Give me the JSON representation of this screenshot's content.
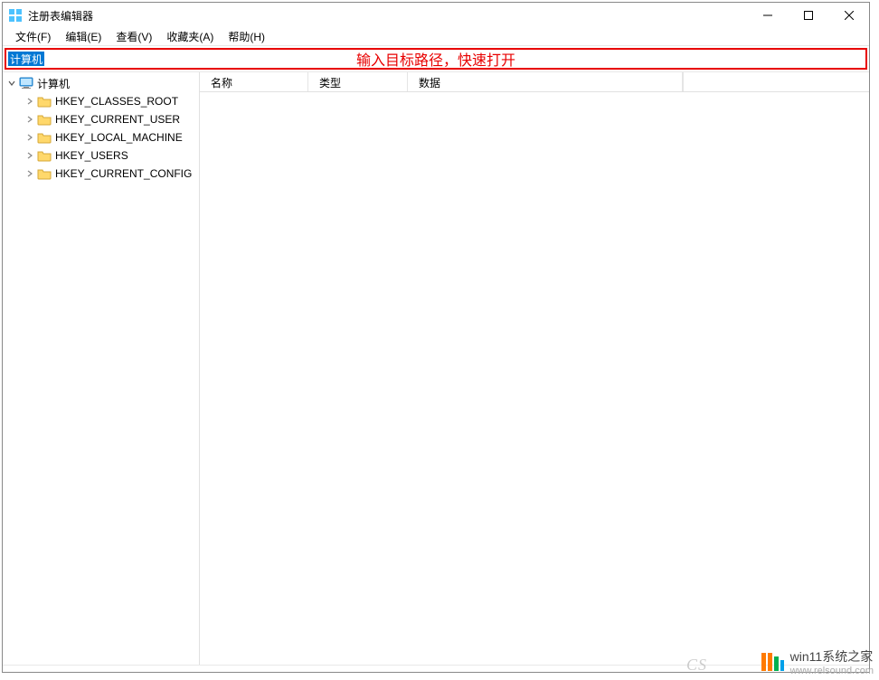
{
  "titlebar": {
    "title": "注册表编辑器"
  },
  "menubar": {
    "items": [
      {
        "label": "文件(F)"
      },
      {
        "label": "编辑(E)"
      },
      {
        "label": "查看(V)"
      },
      {
        "label": "收藏夹(A)"
      },
      {
        "label": "帮助(H)"
      }
    ]
  },
  "addressbar": {
    "value": "计算机",
    "annotation": "输入目标路径，快速打开"
  },
  "tree": {
    "root": {
      "label": "计算机",
      "icon": "computer-icon",
      "expanded": true
    },
    "children": [
      {
        "label": "HKEY_CLASSES_ROOT"
      },
      {
        "label": "HKEY_CURRENT_USER"
      },
      {
        "label": "HKEY_LOCAL_MACHINE"
      },
      {
        "label": "HKEY_USERS"
      },
      {
        "label": "HKEY_CURRENT_CONFIG"
      }
    ]
  },
  "list": {
    "columns": {
      "name": "名称",
      "type": "类型",
      "data": "数据"
    },
    "rows": []
  },
  "watermark": {
    "cs": "CS",
    "title": "win11系统之家",
    "url": "www.relsound.com"
  }
}
